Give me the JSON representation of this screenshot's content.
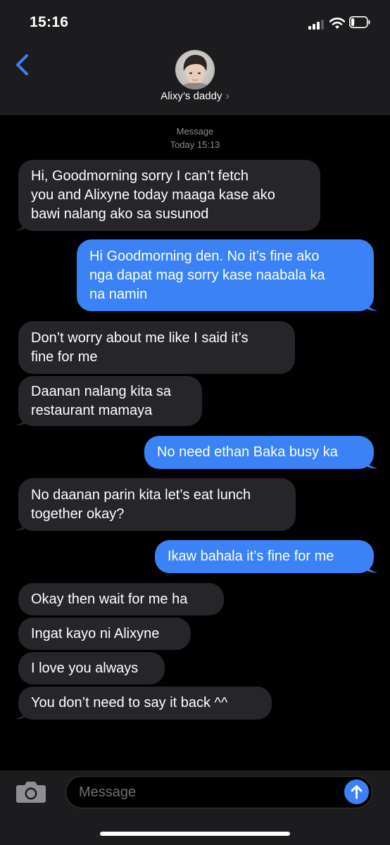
{
  "status_bar": {
    "time": "15:16",
    "signal_icon": "cellular-signal-icon",
    "wifi_icon": "wifi-icon",
    "battery_icon": "battery-low-icon",
    "battery_level": 0.2
  },
  "header": {
    "back_icon": "chevron-left-icon",
    "contact_name": "Alixy’s daddy",
    "name_chevron": "›"
  },
  "thread": {
    "service": "Message",
    "timestamp": "Today 15:13",
    "messages": [
      {
        "direction": "in",
        "lines": [
          "Hi, Goodmorning sorry I can’t fetch",
          "you and Alixyne today maaga kase ako",
          "bawi nalang ako sa susunod"
        ]
      },
      {
        "direction": "out",
        "lines": [
          "Hi Goodmorning den. No it’s fine ako",
          "nga dapat mag sorry kase naabala ka",
          "na namin"
        ]
      },
      {
        "direction": "in",
        "lines": [
          "Don’t worry about me like I said it’s",
          "fine for me"
        ]
      },
      {
        "direction": "in",
        "lines": [
          "Daanan nalang kita sa",
          "restaurant mamaya"
        ]
      },
      {
        "direction": "out",
        "lines": [
          "No need ethan Baka busy ka"
        ]
      },
      {
        "direction": "in",
        "lines": [
          "No daanan parin kita let’s eat lunch",
          "together okay?"
        ]
      },
      {
        "direction": "out",
        "lines": [
          "Ikaw bahala it’s fine for me"
        ]
      },
      {
        "direction": "in",
        "lines": [
          "Okay then wait for me ha"
        ]
      },
      {
        "direction": "in",
        "lines": [
          "Ingat kayo ni Alixyne"
        ]
      },
      {
        "direction": "in",
        "lines": [
          "I love you always"
        ]
      },
      {
        "direction": "in",
        "lines": [
          "You don’t need to say it back ^^"
        ]
      }
    ]
  },
  "composer": {
    "camera_icon": "camera-icon",
    "placeholder": "Message",
    "send_icon": "arrow-up-icon"
  },
  "colors": {
    "background": "#000000",
    "header_bg": "#1c1c1e",
    "incoming_bubble": "#26252a",
    "outgoing_bubble": "#3b82f6",
    "accent": "#3b82f6",
    "meta_text": "#8e8e93"
  }
}
